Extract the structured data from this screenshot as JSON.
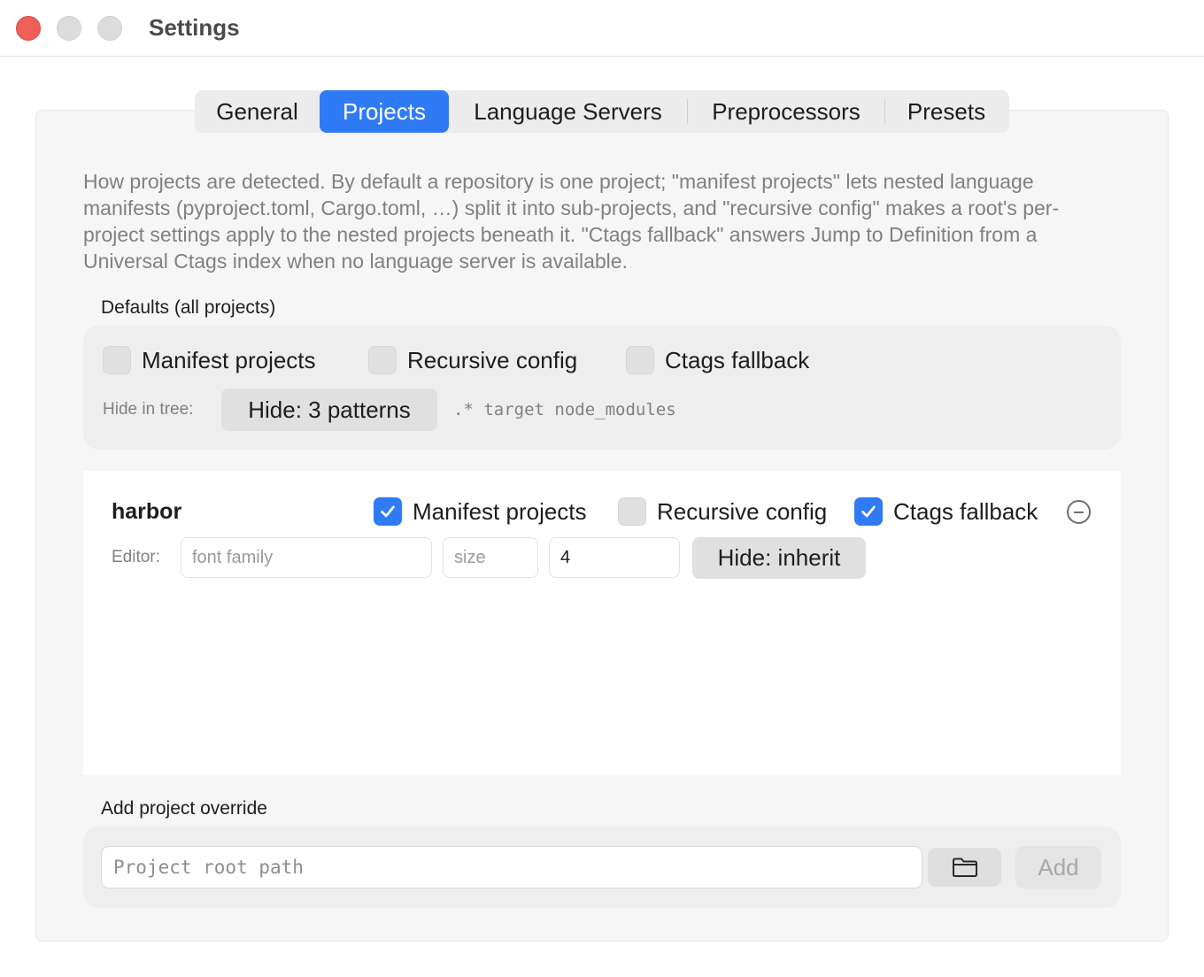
{
  "window": {
    "title": "Settings"
  },
  "tabs": [
    {
      "label": "General",
      "active": false
    },
    {
      "label": "Projects",
      "active": true
    },
    {
      "label": "Language Servers",
      "active": false
    },
    {
      "label": "Preprocessors",
      "active": false
    },
    {
      "label": "Presets",
      "active": false
    }
  ],
  "description": "How projects are detected. By default a repository is one project; \"manifest projects\" lets nested language manifests (pyproject.toml, Cargo.toml, …) split it into sub-projects, and \"recursive config\" makes a root's per-project settings apply to the nested projects beneath it. \"Ctags fallback\" answers Jump to Definition from a Universal Ctags index when no language server is available.",
  "defaults": {
    "label": "Defaults (all projects)",
    "options": [
      {
        "label": "Manifest projects",
        "checked": false
      },
      {
        "label": "Recursive config",
        "checked": false
      },
      {
        "label": "Ctags fallback",
        "checked": false
      }
    ],
    "hide_label": "Hide in tree:",
    "hide_button": "Hide: 3 patterns",
    "hide_patterns": ".* target node_modules"
  },
  "project": {
    "name": "harbor",
    "options": [
      {
        "label": "Manifest projects",
        "checked": true
      },
      {
        "label": "Recursive config",
        "checked": false
      },
      {
        "label": "Ctags fallback",
        "checked": true
      }
    ],
    "editor_label": "Editor:",
    "font_family_placeholder": "font family",
    "size_placeholder": "size",
    "tab_value": "4",
    "hide_button": "Hide: inherit"
  },
  "add_override": {
    "label": "Add project override",
    "path_placeholder": "Project root path",
    "add_label": "Add"
  },
  "colors": {
    "accent": "#2f7bf5",
    "close": "#ed5f57"
  },
  "icons": {
    "remove": "minus-circle-icon",
    "browse": "folder-icon",
    "check": "checkmark-icon"
  }
}
